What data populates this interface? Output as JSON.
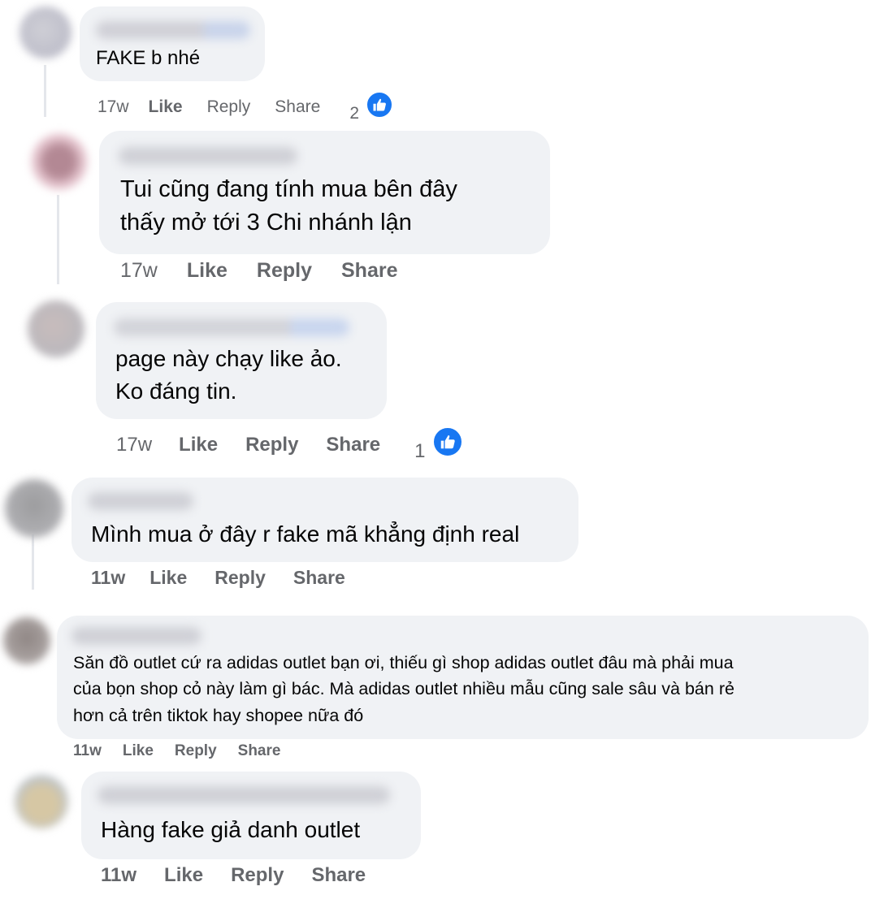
{
  "colors": {
    "bubble": "#f0f2f5",
    "meta": "#65676b",
    "like_blue": "#1877f2"
  },
  "labels": {
    "like": "Like",
    "reply": "Reply",
    "share": "Share"
  },
  "comments": [
    {
      "text": "FAKE b nhé",
      "time": "17w",
      "reactions": "2"
    },
    {
      "text": "Tui cũng đang tính mua bên đây\nthấy mở tới 3 Chi nhánh lận",
      "time": "17w"
    },
    {
      "text": "page này chạy like ảo.\nKo đáng tin.",
      "time": "17w",
      "reactions": "1"
    },
    {
      "text": "Mình mua ở đây r fake mã khẳng định real",
      "time": "11w"
    },
    {
      "text": "Săn đồ outlet cứ ra adidas outlet bạn ơi, thiếu gì shop adidas outlet đâu mà phải mua\ncủa bọn shop cỏ này làm gì bác. Mà adidas outlet nhiều mẫu cũng sale sâu và bán rẻ\nhơn cả trên tiktok hay shopee nữa đó",
      "time": "11w"
    },
    {
      "text": "Hàng fake giả danh outlet",
      "time": "11w"
    }
  ]
}
